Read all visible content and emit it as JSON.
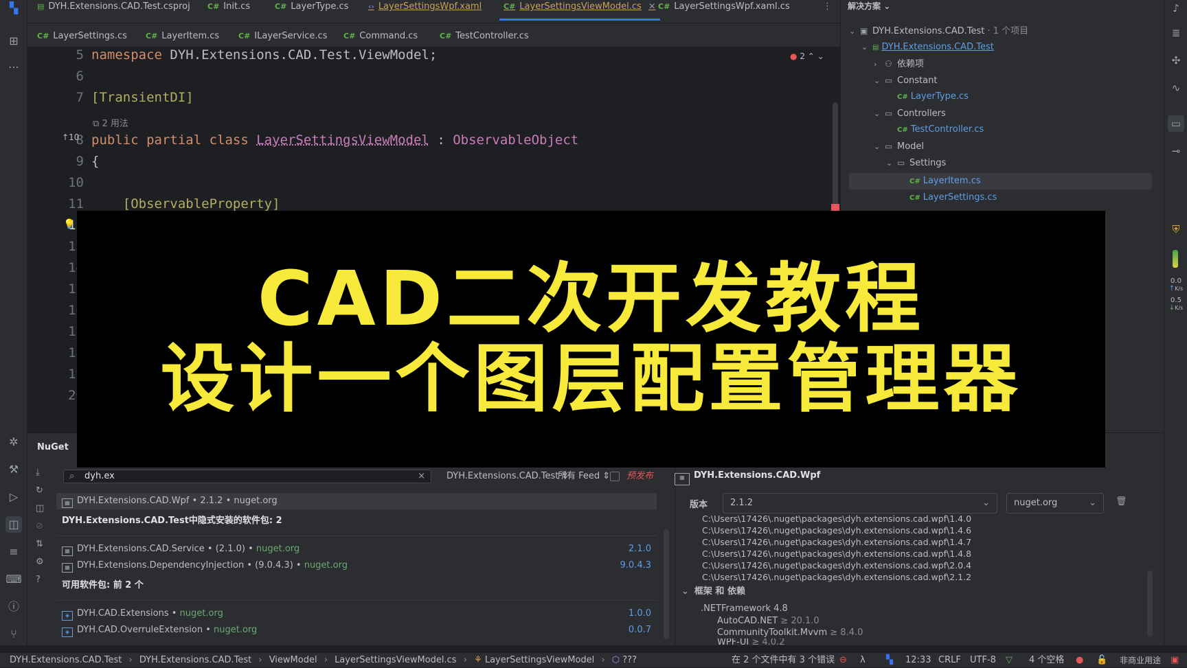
{
  "tabs_row1": [
    {
      "label": "DYH.Extensions.CAD.Test.csproj",
      "kind": "proj"
    },
    {
      "label": "Init.cs",
      "kind": "cs"
    },
    {
      "label": "LayerType.cs",
      "kind": "cs"
    },
    {
      "label": "LayerSettingsWpf.xaml",
      "kind": "xaml"
    },
    {
      "label": "LayerSettingsViewModel.cs",
      "kind": "cs",
      "active": true
    },
    {
      "label": "LayerSettingsWpf.xaml.cs",
      "kind": "cs"
    }
  ],
  "tabs_row2": [
    "LayerSettings.cs",
    "LayerItem.cs",
    "ILayerService.cs",
    "Command.cs",
    "TestController.cs"
  ],
  "tab_cs_prefix": "C#",
  "editor": {
    "error_count": "2",
    "usages_hint": "2 用法",
    "impl_count": "10",
    "lines": [
      {
        "n": "5",
        "text": "namespace DYH.Extensions.CAD.Test.ViewModel;"
      },
      {
        "n": "6",
        "text": ""
      },
      {
        "n": "7",
        "text": "[TransientDI]"
      },
      {
        "n": "8",
        "text": "public partial class LayerSettingsViewModel : ObservableObject"
      },
      {
        "n": "9",
        "text": "{"
      },
      {
        "n": "10",
        "text": ""
      },
      {
        "n": "11",
        "text": "    [ObservableProperty]"
      },
      {
        "n": "12",
        "text": ""
      },
      {
        "n": "13",
        "text": ""
      },
      {
        "n": "14",
        "text": ""
      },
      {
        "n": "15",
        "text": ""
      },
      {
        "n": "16",
        "text": ""
      },
      {
        "n": "17",
        "text": ""
      },
      {
        "n": "18",
        "text": ""
      },
      {
        "n": "19",
        "text": ""
      },
      {
        "n": "20",
        "text": ""
      }
    ]
  },
  "banner": {
    "line1": "CAD二次开发教程",
    "line2": "设计一个图层配置管理器",
    "color": "#f7ea3b"
  },
  "solution": {
    "header": "解决方案",
    "root": "DYH.Extensions.CAD.Test",
    "root_count": "· 1 个项目",
    "items": [
      {
        "label": "DYH.Extensions.CAD.Test",
        "depth": 1,
        "type": "project"
      },
      {
        "label": "依赖项",
        "depth": 2,
        "type": "deps"
      },
      {
        "label": "Constant",
        "depth": 2,
        "type": "folder"
      },
      {
        "label": "LayerType.cs",
        "depth": 3,
        "type": "cs"
      },
      {
        "label": "Controllers",
        "depth": 2,
        "type": "folder"
      },
      {
        "label": "TestController.cs",
        "depth": 3,
        "type": "cs"
      },
      {
        "label": "Model",
        "depth": 2,
        "type": "folder"
      },
      {
        "label": "Settings",
        "depth": 3,
        "type": "folder"
      },
      {
        "label": "LayerItem.cs",
        "depth": 4,
        "type": "cs",
        "selected": true
      },
      {
        "label": "LayerSettings.cs",
        "depth": 4,
        "type": "cs"
      }
    ]
  },
  "nuget": {
    "title": "NuGet",
    "search_value": "dyh.ex",
    "project_filter": "DYH.Extensions.CAD.Test",
    "feed_filter": "所有 Feed",
    "prerelease_label": "预发布",
    "selected_pkg": "DYH.Extensions.CAD.Wpf • 2.1.2 • nuget.org",
    "implicit_header": "DYH.Extensions.CAD.Test中隐式安装的软件包: 2",
    "implicit": [
      {
        "name": "DYH.Extensions.CAD.Service • (2.1.0) • ",
        "src": "nuget.org",
        "ver": "2.1.0"
      },
      {
        "name": "DYH.Extensions.DependencyInjection • (9.0.4.3) • ",
        "src": "nuget.org",
        "ver": "9.0.4.3"
      }
    ],
    "available_header": "可用软件包: 前 2 个",
    "available": [
      {
        "name": "DYH.CAD.Extensions • ",
        "src": "nuget.org",
        "ver": "1.0.0"
      },
      {
        "name": "DYH.CAD.OverruleExtension • ",
        "src": "nuget.org",
        "ver": "0.0.7"
      }
    ],
    "detail": {
      "name": "DYH.Extensions.CAD.Wpf",
      "version_label": "版本",
      "version_value": "2.1.2",
      "source_value": "nuget.org",
      "paths": [
        "C:\\Users\\17426\\.nuget\\packages\\dyh.extensions.cad.wpf\\1.4.0",
        "C:\\Users\\17426\\.nuget\\packages\\dyh.extensions.cad.wpf\\1.4.6",
        "C:\\Users\\17426\\.nuget\\packages\\dyh.extensions.cad.wpf\\1.4.7",
        "C:\\Users\\17426\\.nuget\\packages\\dyh.extensions.cad.wpf\\1.4.8",
        "C:\\Users\\17426\\.nuget\\packages\\dyh.extensions.cad.wpf\\2.0.4",
        "C:\\Users\\17426\\.nuget\\packages\\dyh.extensions.cad.wpf\\2.1.2"
      ],
      "deps_header": "框架 和 依赖",
      "framework": ".NETFramework 4.8",
      "deps": [
        {
          "name": "AutoCAD.NET",
          "ver": "≥ 20.1.0"
        },
        {
          "name": "CommunityToolkit.Mvvm",
          "ver": "≥ 8.4.0"
        },
        {
          "name": "WPF-UI",
          "ver": "≥ 4.0.2"
        }
      ]
    }
  },
  "statusbar": {
    "breadcrumb": [
      "DYH.Extensions.CAD.Test",
      "DYH.Extensions.CAD.Test",
      "ViewModel",
      "LayerSettingsViewModel.cs",
      "LayerSettingsViewModel",
      "???"
    ],
    "errors": "在 2 个文件中有 3 个错误",
    "position": "12:33",
    "line_ending": "CRLF",
    "encoding": "UTF-8",
    "indent": "4 个空格",
    "license": "非商业用途"
  },
  "net_speed": {
    "up": "0.0",
    "down": "0.5",
    "unit": "K/s"
  }
}
